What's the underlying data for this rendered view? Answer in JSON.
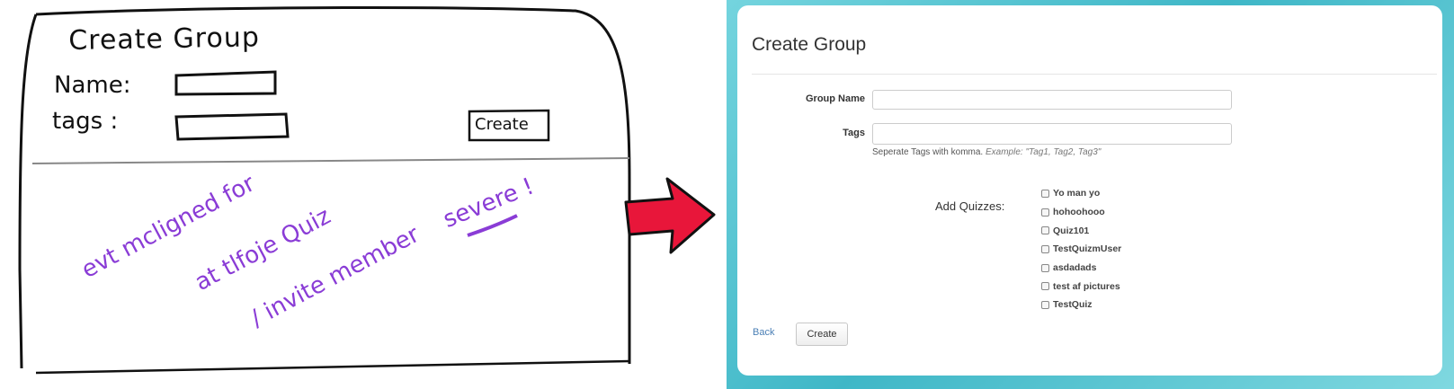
{
  "sketch": {
    "title": "Create Group",
    "name_label": "Name:",
    "tags_label": "tags :",
    "create_button": "Create",
    "note_lines": [
      "evt mcligned for",
      "at tlfoje Quiz",
      "/ invite member",
      "severe !"
    ],
    "note_color": "#8a3cd6"
  },
  "arrow": {
    "color": "#e8163a"
  },
  "form": {
    "title": "Create Group",
    "group_name_label": "Group Name",
    "group_name_value": "",
    "tags_label": "Tags",
    "tags_value": "",
    "tags_help": "Seperate Tags with komma.",
    "tags_help_example": "Example: \"Tag1, Tag2, Tag3\"",
    "add_quizzes_label": "Add Quizzes:",
    "quizzes": [
      {
        "label": "Yo man yo",
        "checked": false
      },
      {
        "label": "hohoohooo",
        "checked": false
      },
      {
        "label": "Quiz101",
        "checked": false
      },
      {
        "label": "TestQuizmUser",
        "checked": false
      },
      {
        "label": "asdadads",
        "checked": false
      },
      {
        "label": "test af pictures",
        "checked": false
      },
      {
        "label": "TestQuiz",
        "checked": false
      }
    ],
    "back_link": "Back",
    "create_button": "Create"
  },
  "colors": {
    "frame_teal": "#3fb7c7",
    "link_blue": "#4a7fb5"
  }
}
